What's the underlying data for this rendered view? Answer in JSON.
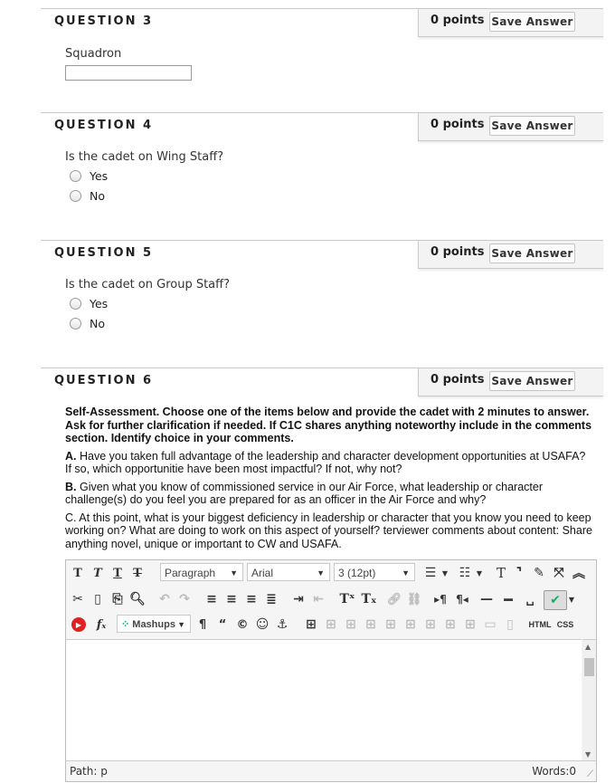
{
  "questions": [
    {
      "title": "QUESTION 3",
      "points": "0 points",
      "save_label": "Save Answer",
      "prompt": "Squadron"
    },
    {
      "title": "QUESTION 4",
      "points": "0 points",
      "save_label": "Save Answer",
      "prompt": "Is the cadet on Wing Staff?",
      "options": [
        "Yes",
        "No"
      ]
    },
    {
      "title": "QUESTION 5",
      "points": "0 points",
      "save_label": "Save Answer",
      "prompt": "Is the cadet on Group Staff?",
      "options": [
        "Yes",
        "No"
      ]
    },
    {
      "title": "QUESTION 6",
      "points": "0 points",
      "save_label": "Save Answer"
    }
  ],
  "q6": {
    "intro": "Self-Assessment. Choose one of the items below and provide the cadet with 2 minutes to answer. Ask for further clarification if needed. If C1C shares anything noteworthy include in the comments section. Identify choice in your comments.",
    "a_label": "A.",
    "a_text": " Have you taken full advantage of the leadership and character development opportunities at USAFA? If so, which opportunitie have been most impactful? If not, why not?",
    "b_label": "B.",
    "b_text": " Given what you know of commissioned service in our Air Force, what leadership or character challenge(s) do you feel you are prepared for as an officer in the Air Force and why?",
    "c_label": "C.",
    "c_text": "  At this point, what is your biggest deficiency in leadership or character that you know you need to keep working on? What are doing to work on this aspect of yourself? terviewer comments about content: Share anything novel, unique or important to CW and USAFA."
  },
  "editor": {
    "format_select": "Paragraph",
    "font_select": "Arial",
    "size_select": "3 (12pt)",
    "mashups_label": "Mashups",
    "html_label": "HTML",
    "css_label": "CSS",
    "path_label": "Path: p",
    "words_label": "Words:0"
  }
}
